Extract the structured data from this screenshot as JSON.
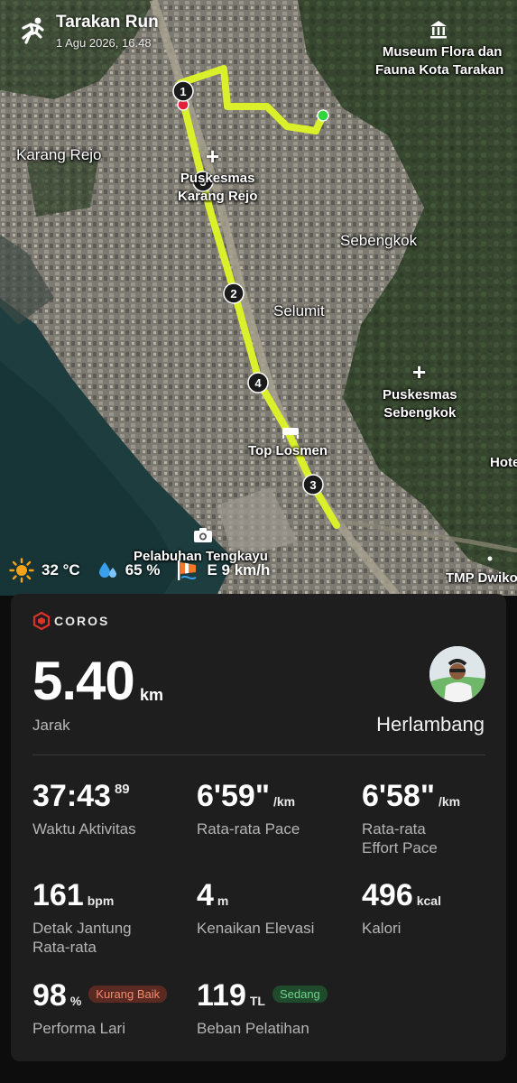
{
  "header": {
    "title": "Tarakan Run",
    "datetime": "1 Agu 2026, 16.48"
  },
  "map": {
    "labels": {
      "museum": "Museum Flora dan Fauna Kota Tarakan",
      "museum_line1": "Museum Flora dan",
      "museum_line2": "Fauna Kota Tarakan",
      "karang_rejo": "Karang Rejo",
      "puskesmas_kr_line1": "Puskesmas",
      "puskesmas_kr_line2": "Karang Rejo",
      "sebengkok": "Sebengkok",
      "selumit": "Selumit",
      "puskesmas_sb_line1": "Puskesmas",
      "puskesmas_sb_line2": "Sebengkok",
      "top_lesmen": "Top Losmen",
      "hotel": "Hote",
      "pelabuhan": "Pelabuhan Tengkayu",
      "tmp": "TMP Dwiko"
    },
    "km_markers": [
      "1",
      "2",
      "3",
      "4",
      "5"
    ],
    "route_color": "#d9f02a"
  },
  "weather": {
    "temperature": "32 °C",
    "humidity": "65 %",
    "wind": "E 9 km/h"
  },
  "card": {
    "brand": "COROS",
    "distance_value": "5.40",
    "distance_unit": "km",
    "distance_label": "Jarak",
    "user_name": "Herlambang",
    "stats": {
      "activity_time": {
        "value": "37:43",
        "sup": "89",
        "label": "Waktu Aktivitas"
      },
      "avg_pace": {
        "value": "6'59\"",
        "unit": "/km",
        "label": "Rata-rata Pace"
      },
      "effort_pace": {
        "value": "6'58\"",
        "unit": "/km",
        "label_line1": "Rata-rata",
        "label_line2": "Effort Pace"
      },
      "heart_rate": {
        "value": "161",
        "unit": "bpm",
        "label_line1": "Detak Jantung",
        "label_line2": "Rata-rata"
      },
      "elevation": {
        "value": "4",
        "unit": "m",
        "label": "Kenaikan Elevasi"
      },
      "calories": {
        "value": "496",
        "unit": "kcal",
        "label": "Kalori"
      },
      "performance": {
        "value": "98",
        "unit": "%",
        "badge": "Kurang Baik",
        "label": "Performa Lari"
      },
      "training_load": {
        "value": "119",
        "unit": "TL",
        "badge": "Sedang",
        "label": "Beban Pelatihan"
      }
    },
    "colors": {
      "badge_bad_text": "#f08a6e",
      "badge_mid_text": "#6fd38a",
      "card_bg": "#1e1e1e"
    }
  }
}
